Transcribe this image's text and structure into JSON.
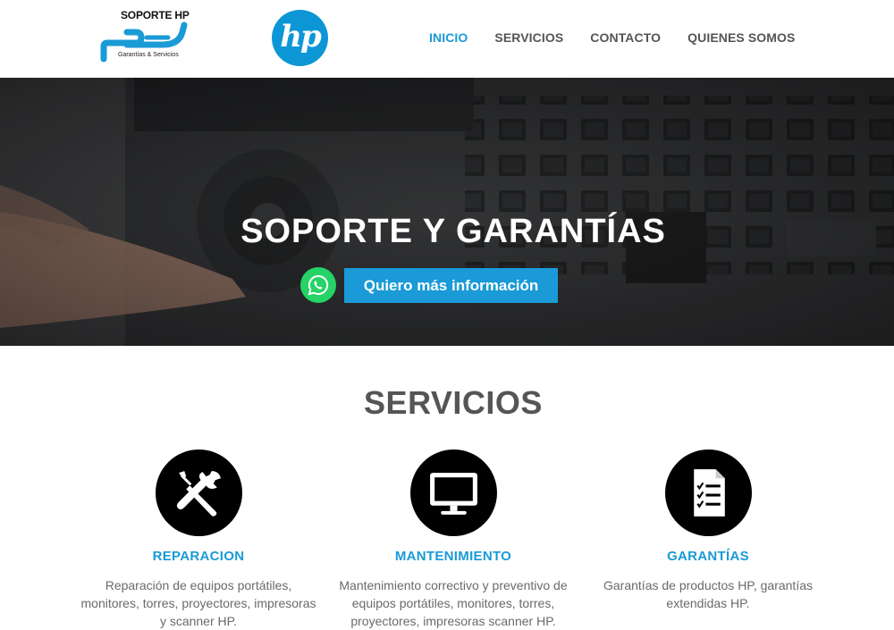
{
  "brand": {
    "title": "SOPORTE HP",
    "subtitle": "Garantías & Servicios",
    "logo_icon": "hp-logo",
    "logo_text": "hp",
    "accent": "#1a9ad6"
  },
  "nav": {
    "items": [
      {
        "label": "INICIO",
        "active": true
      },
      {
        "label": "SERVICIOS",
        "active": false
      },
      {
        "label": "CONTACTO",
        "active": false
      },
      {
        "label": "QUIENES SOMOS",
        "active": false
      }
    ]
  },
  "hero": {
    "title": "SOPORTE Y GARANTÍAS",
    "cta_label": "Quiero más información",
    "cta_icon": "whatsapp-icon"
  },
  "services": {
    "title": "SERVICIOS",
    "items": [
      {
        "icon": "tools-icon",
        "label": "REPARACION",
        "desc": "Reparación de equipos portátiles, monitores, torres, proyectores, impresoras y scanner HP."
      },
      {
        "icon": "monitor-icon",
        "label": "MANTENIMIENTO",
        "desc": "Mantenimiento correctivo y preventivo de equipos portátiles, monitores, torres, proyectores, impresoras scanner HP."
      },
      {
        "icon": "checklist-icon",
        "label": "GARANTÍAS",
        "desc": "Garantías de productos HP, garantías extendidas HP."
      }
    ]
  }
}
